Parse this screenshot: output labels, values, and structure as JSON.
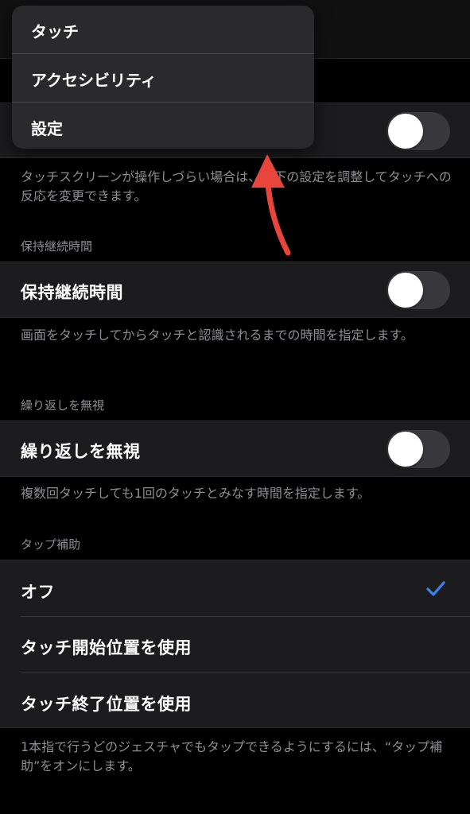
{
  "menu": {
    "items": [
      {
        "label": "タッチ"
      },
      {
        "label": "アクセシビリティ"
      },
      {
        "label": "設定"
      }
    ]
  },
  "sections": {
    "first_footer": "タッチスクリーンが操作しづらい場合は、以下の設定を調整してタッチへの反応を変更できます。",
    "hold": {
      "header": "保持継続時間",
      "label": "保持継続時間",
      "toggle_on": false,
      "footer": "画面をタッチしてからタッチと認識されるまでの時間を指定します。"
    },
    "ignore": {
      "header": "繰り返しを無視",
      "label": "繰り返しを無視",
      "toggle_on": false,
      "footer": "複数回タッチしても1回のタッチとみなす時間を指定します。"
    },
    "tap_assist": {
      "header": "タップ補助",
      "options": [
        {
          "label": "オフ",
          "selected": true
        },
        {
          "label": "タッチ開始位置を使用",
          "selected": false
        },
        {
          "label": "タッチ終了位置を使用",
          "selected": false
        }
      ],
      "footer": "1本指で行うどのジェスチャでもタップできるようにするには、“タップ補助”をオンにします。"
    }
  },
  "colors": {
    "accent": "#3b82f6",
    "annotation_arrow": "#e8453c"
  }
}
